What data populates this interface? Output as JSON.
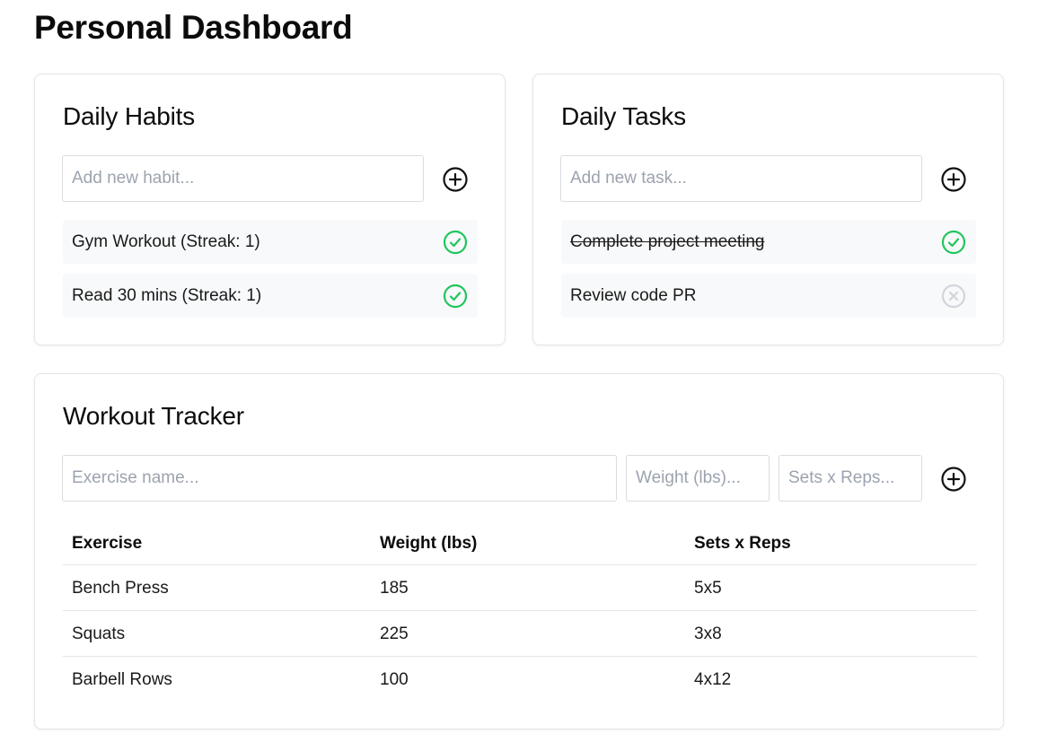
{
  "page": {
    "title": "Personal Dashboard"
  },
  "habits": {
    "title": "Daily Habits",
    "input_placeholder": "Add new habit...",
    "add_icon": "plus-circle-icon",
    "items": [
      {
        "label": "Gym Workout (Streak: 1)",
        "status": "completed",
        "icon": "check-circle-icon"
      },
      {
        "label": "Read 30 mins (Streak: 1)",
        "status": "completed",
        "icon": "check-circle-icon"
      }
    ]
  },
  "tasks": {
    "title": "Daily Tasks",
    "input_placeholder": "Add new task...",
    "add_icon": "plus-circle-icon",
    "items": [
      {
        "label": "Complete project meeting",
        "status": "completed",
        "icon": "check-circle-icon"
      },
      {
        "label": "Review code PR",
        "status": "pending",
        "icon": "x-circle-icon"
      }
    ]
  },
  "workout": {
    "title": "Workout Tracker",
    "exercise_placeholder": "Exercise name...",
    "weight_placeholder": "Weight (lbs)...",
    "sets_placeholder": "Sets x Reps...",
    "add_icon": "plus-circle-icon",
    "columns": [
      "Exercise",
      "Weight (lbs)",
      "Sets x Reps"
    ],
    "rows": [
      [
        "Bench Press",
        "185",
        "5x5"
      ],
      [
        "Squats",
        "225",
        "3x8"
      ],
      [
        "Barbell Rows",
        "100",
        "4x12"
      ]
    ]
  },
  "colors": {
    "success": "#22c55e",
    "muted": "#d1d5db",
    "border": "#e3e5e8",
    "item_bg": "#f8f9fa"
  }
}
